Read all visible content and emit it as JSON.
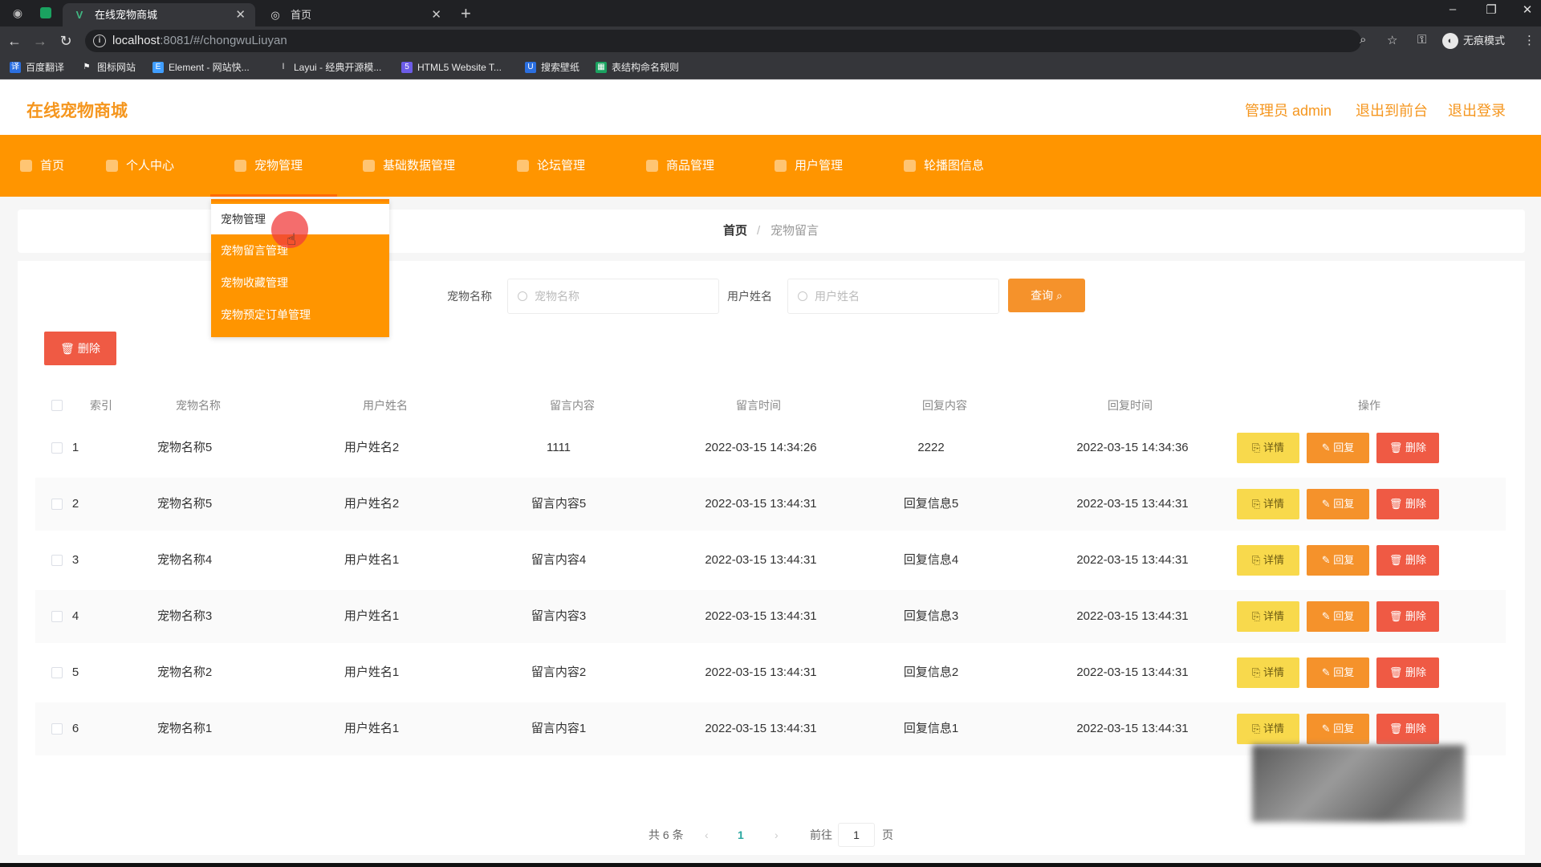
{
  "browser": {
    "tabs": [
      {
        "title": "在线宠物商城",
        "active": true,
        "icon": "vue-icon"
      },
      {
        "title": "首页",
        "active": false,
        "icon": "globe-icon"
      }
    ],
    "url_host": "localhost",
    "url_rest": ":8081/#/chongwuLiuyan",
    "incognito": "无痕模式",
    "bookmarks": [
      "百度翻译",
      "图标网站",
      "Element - 网站快...",
      "Layui - 经典开源模...",
      "HTML5 Website T...",
      "搜索壁纸",
      "表结构命名规则"
    ]
  },
  "header": {
    "logo": "在线宠物商城",
    "admin": "管理员 admin",
    "to_front": "退出到前台",
    "logout": "退出登录"
  },
  "nav": [
    {
      "label": "首页",
      "icon": "home-icon"
    },
    {
      "label": "个人中心",
      "icon": "user-icon"
    },
    {
      "label": "宠物管理",
      "icon": "pet-icon"
    },
    {
      "label": "基础数据管理",
      "icon": "data-icon"
    },
    {
      "label": "论坛管理",
      "icon": "forum-icon"
    },
    {
      "label": "商品管理",
      "icon": "goods-icon"
    },
    {
      "label": "用户管理",
      "icon": "users-icon"
    },
    {
      "label": "轮播图信息",
      "icon": "carousel-icon"
    }
  ],
  "dropdown": [
    "宠物管理",
    "宠物留言管理",
    "宠物收藏管理",
    "宠物预定订单管理"
  ],
  "breadcrumb": {
    "home": "首页",
    "sep": "/",
    "current": "宠物留言"
  },
  "search": {
    "pet_label": "宠物名称",
    "pet_placeholder": "宠物名称",
    "user_label": "用户姓名",
    "user_placeholder": "用户姓名",
    "query": "查询"
  },
  "bulk_delete": "删除",
  "table": {
    "headers": [
      "索引",
      "宠物名称",
      "用户姓名",
      "留言内容",
      "留言时间",
      "回复内容",
      "回复时间",
      "操作"
    ],
    "rows": [
      [
        "1",
        "宠物名称5",
        "用户姓名2",
        "1111",
        "2022-03-15 14:34:26",
        "2222",
        "2022-03-15 14:34:36"
      ],
      [
        "2",
        "宠物名称5",
        "用户姓名2",
        "留言内容5",
        "2022-03-15 13:44:31",
        "回复信息5",
        "2022-03-15 13:44:31"
      ],
      [
        "3",
        "宠物名称4",
        "用户姓名1",
        "留言内容4",
        "2022-03-15 13:44:31",
        "回复信息4",
        "2022-03-15 13:44:31"
      ],
      [
        "4",
        "宠物名称3",
        "用户姓名1",
        "留言内容3",
        "2022-03-15 13:44:31",
        "回复信息3",
        "2022-03-15 13:44:31"
      ],
      [
        "5",
        "宠物名称2",
        "用户姓名1",
        "留言内容2",
        "2022-03-15 13:44:31",
        "回复信息2",
        "2022-03-15 13:44:31"
      ],
      [
        "6",
        "宠物名称1",
        "用户姓名1",
        "留言内容1",
        "2022-03-15 13:44:31",
        "回复信息1",
        "2022-03-15 13:44:31"
      ]
    ],
    "actions": {
      "detail": "详情",
      "reply": "回复",
      "delete": "删除"
    }
  },
  "pagination": {
    "total": "共 6 条",
    "current": "1",
    "goto": "前往",
    "page_value": "1",
    "page_unit": "页"
  },
  "colors": {
    "accent": "#ff9500",
    "danger": "#ef5a44",
    "warning": "#f8d94c"
  }
}
